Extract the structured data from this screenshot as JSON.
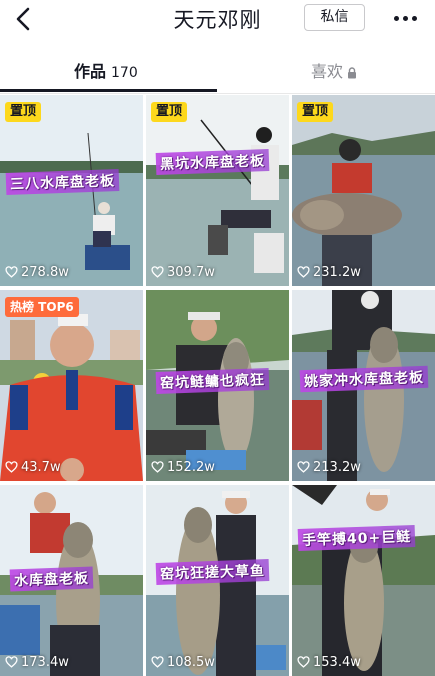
{
  "header": {
    "back_icon": "back-chevron-icon",
    "title": "天元邓刚",
    "message_button": "私信",
    "more_icon": "more-dots-icon"
  },
  "tabs": {
    "works_label": "作品",
    "works_count": "170",
    "likes_label": "喜欢",
    "likes_icon": "lock-icon"
  },
  "videos": [
    {
      "badge": "置顶",
      "caption": "三八水库盘老板",
      "likes": "278.8w"
    },
    {
      "badge": "置顶",
      "caption": "黑坑水库盘老板",
      "likes": "309.7w"
    },
    {
      "badge": "置顶",
      "caption": "",
      "likes": "231.2w"
    },
    {
      "badge": "热榜 TOP6",
      "caption": "",
      "likes": "43.7w"
    },
    {
      "badge": "",
      "caption": "窑坑鲢鳙也疯狂",
      "likes": "152.2w"
    },
    {
      "badge": "",
      "caption": "姚家冲水库盘老板",
      "likes": "213.2w"
    },
    {
      "badge": "",
      "caption": "水库盘老板",
      "likes": "173.4w"
    },
    {
      "badge": "",
      "caption": "窑坑狂搓大草鱼",
      "likes": "108.5w"
    },
    {
      "badge": "",
      "caption": "手竿搏40+巨鲢",
      "likes": "153.4w"
    }
  ],
  "colors": {
    "pin_badge": "#fdd81c",
    "hot_badge": "#fe6b3b",
    "caption_bg": "#b446e6",
    "tab_underline": "#161823"
  }
}
